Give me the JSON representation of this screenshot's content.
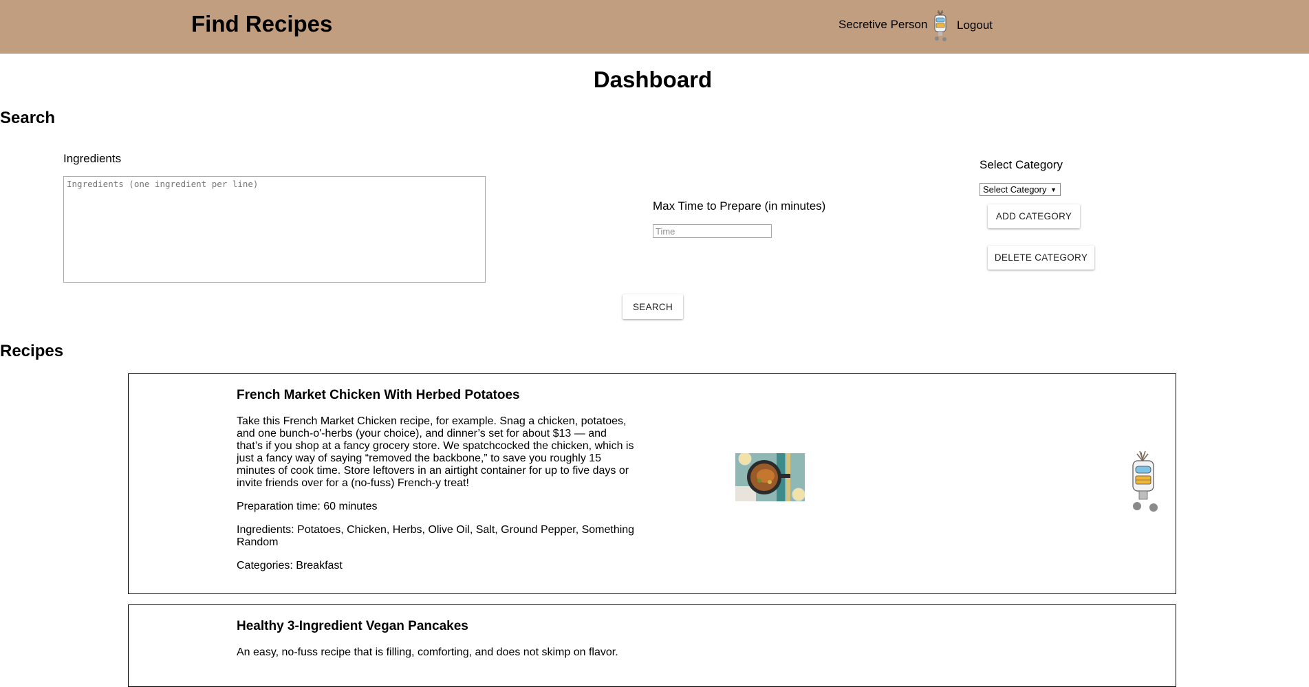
{
  "header": {
    "app_title": "Find Recipes",
    "user_name": "Secretive Person",
    "logout_label": "Logout",
    "background_color": "#c19e7f"
  },
  "page_title": "Dashboard",
  "search": {
    "heading": "Search",
    "ingredients_label": "Ingredients",
    "ingredients_placeholder": "Ingredients (one ingredient per line)",
    "ingredients_value": "",
    "max_time_label": "Max Time to Prepare (in minutes)",
    "time_placeholder": "Time",
    "time_value": "",
    "category_label": "Select Category",
    "category_selected": "Select Category",
    "add_category_label": "ADD CATEGORY",
    "delete_category_label": "DELETE CATEGORY",
    "search_button_label": "SEARCH"
  },
  "recipes": {
    "heading": "Recipes",
    "items": [
      {
        "title": "French Market Chicken With Herbed Potatoes",
        "description": "Take this French Market Chicken recipe, for example. Snag a chicken, potatoes, and one bunch-o'-herbs (your choice), and dinner’s set for about $13 — and that’s if you shop at a fancy grocery store. We spatchcocked the chicken, which is just a fancy way of saying “removed the backbone,” to save you roughly 15 minutes of cook time. Store leftovers in an airtight container for up to five days or invite friends over for a (no-fuss) French-y treat!",
        "prep_time": "Preparation time: 60 minutes",
        "ingredients": "Ingredients: Potatoes, Chicken, Herbs, Olive Oil, Salt, Ground Pepper, Something Random",
        "categories": "Categories: Breakfast"
      },
      {
        "title": "Healthy 3-Ingredient Vegan Pancakes",
        "description": "An easy, no-fuss recipe that is filling, comforting, and does not skimp on flavor."
      }
    ]
  }
}
